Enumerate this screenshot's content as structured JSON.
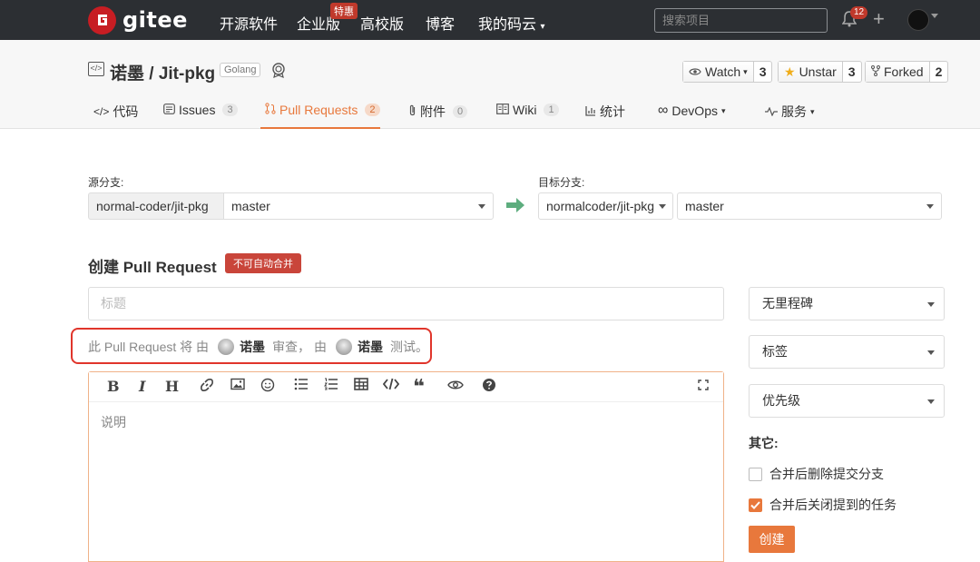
{
  "nav": {
    "brand": "gitee",
    "links": [
      "开源软件",
      "企业版",
      "高校版",
      "博客",
      "我的码云"
    ],
    "enterprise_badge": "特惠",
    "search_placeholder": "搜索项目",
    "notification_count": "12"
  },
  "repo": {
    "title": "诺墨 / Jit-pkg",
    "language": "Golang",
    "watch_label": "Watch",
    "watch_count": "3",
    "unstar_label": "Unstar",
    "unstar_count": "3",
    "fork_label": "Forked",
    "fork_count": "2"
  },
  "tabs": [
    {
      "label": "代码",
      "count": ""
    },
    {
      "label": "Issues",
      "count": "3"
    },
    {
      "label": "Pull Requests",
      "count": "2"
    },
    {
      "label": "附件",
      "count": "0"
    },
    {
      "label": "Wiki",
      "count": "1"
    },
    {
      "label": "统计",
      "count": ""
    },
    {
      "label": "DevOps",
      "count": ""
    },
    {
      "label": "服务",
      "count": ""
    }
  ],
  "branches": {
    "source_label": "源分支:",
    "source_repo": "normal-coder/jit-pkg",
    "source_branch": "master",
    "target_label": "目标分支:",
    "target_repo": "normalcoder/jit-pkg",
    "target_branch": "master"
  },
  "form": {
    "heading": "创建 Pull Request",
    "merge_badge": "不可自动合并",
    "title_placeholder": "标题",
    "review_prefix": "此 Pull Request 将 由",
    "reviewer": "诺墨",
    "review_mid": "审查， 由",
    "tester": "诺墨",
    "review_suffix": "测试。",
    "description_placeholder": "说明"
  },
  "sidebar": {
    "milestone": "无里程碑",
    "labels": "标签",
    "priority": "优先级",
    "other_label": "其它:",
    "option_delete_branch": "合并后删除提交分支",
    "option_close_tasks": "合并后关闭提到的任务",
    "delete_branch_checked": false,
    "close_tasks_checked": true,
    "create_button": "创建"
  },
  "colors": {
    "accent": "#e8783c",
    "brand_red": "#c71d23",
    "nav_bg": "#2c2f33"
  }
}
